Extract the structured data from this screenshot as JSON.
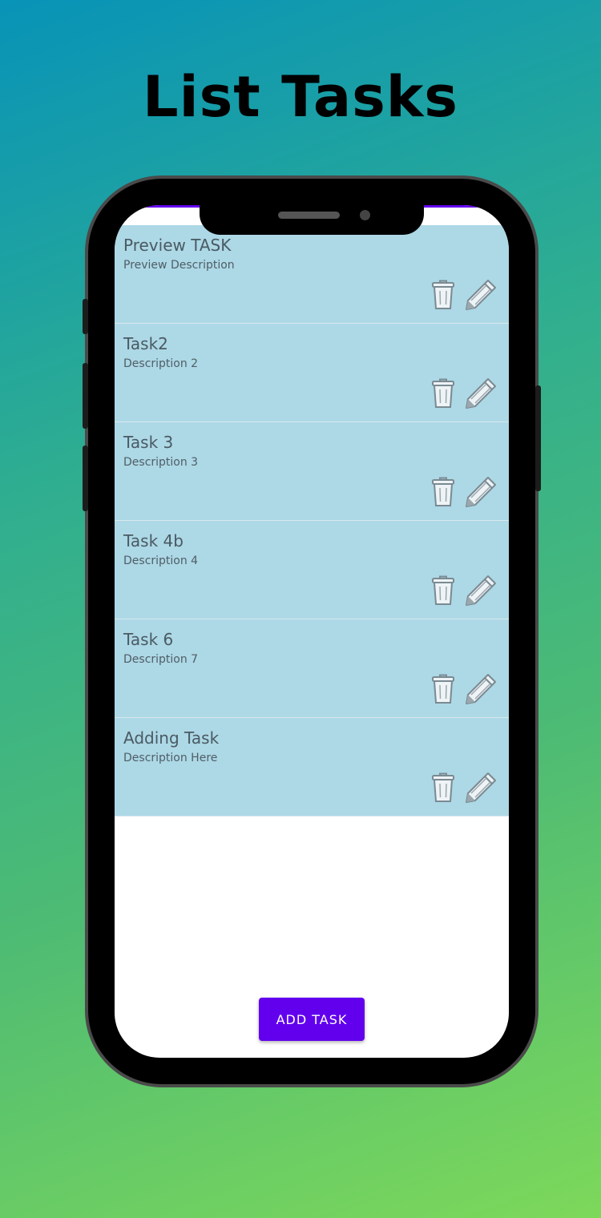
{
  "page": {
    "title": "List Tasks"
  },
  "tasks": [
    {
      "title": "Preview TASK",
      "description": "Preview Description"
    },
    {
      "title": "Task2",
      "description": "Description 2"
    },
    {
      "title": "Task 3",
      "description": "Description 3"
    },
    {
      "title": "Task 4b",
      "description": "Description 4"
    },
    {
      "title": "Task 6",
      "description": "Description 7"
    },
    {
      "title": "Adding Task",
      "description": "Description Here"
    }
  ],
  "icons": {
    "delete": "trash-icon",
    "edit": "pencil-icon"
  },
  "actions": {
    "add_label": "ADD TASK"
  },
  "colors": {
    "accent": "#6200ee",
    "item_background": "#add8e6"
  }
}
